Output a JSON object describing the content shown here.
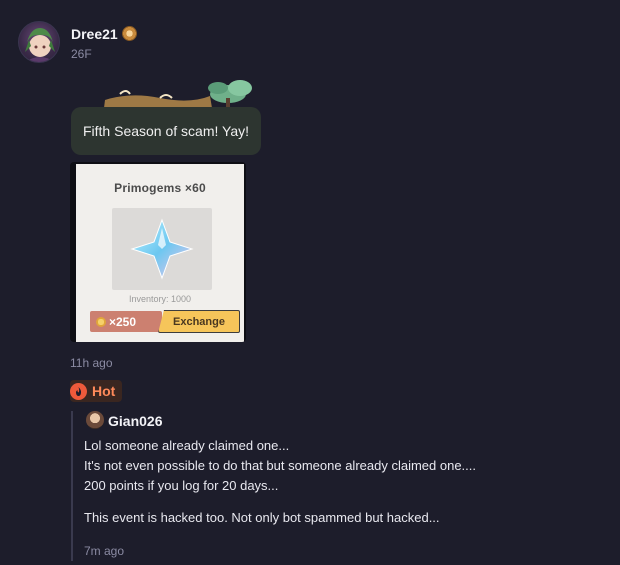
{
  "post": {
    "username": "Dree21",
    "floor": "26F",
    "bubble_text": "Fifth Season of scam! Yay!",
    "timestamp": "11h ago"
  },
  "shop_card": {
    "title": "Primogems ×60",
    "inventory": "Inventory: 1000",
    "price": "×250",
    "button_label": "Exchange"
  },
  "hot_badge": {
    "label": "Hot"
  },
  "reply": {
    "username": "Gian026",
    "lines": [
      "Lol someone already claimed one...",
      "It's not even possible to do that but someone already claimed one....",
      "200 points if you log for 20 days...",
      "This event is hacked too. Not only bot spammed but hacked..."
    ],
    "timestamp": "7m ago"
  },
  "colors": {
    "background": "#1d1d2b",
    "bubble": "#2d3530",
    "hot": "#ee5a3b",
    "exchange": "#f6c55a"
  },
  "icons": [
    "avatar",
    "level-badge-icon",
    "primogem-icon",
    "coin-icon",
    "flame-icon"
  ]
}
